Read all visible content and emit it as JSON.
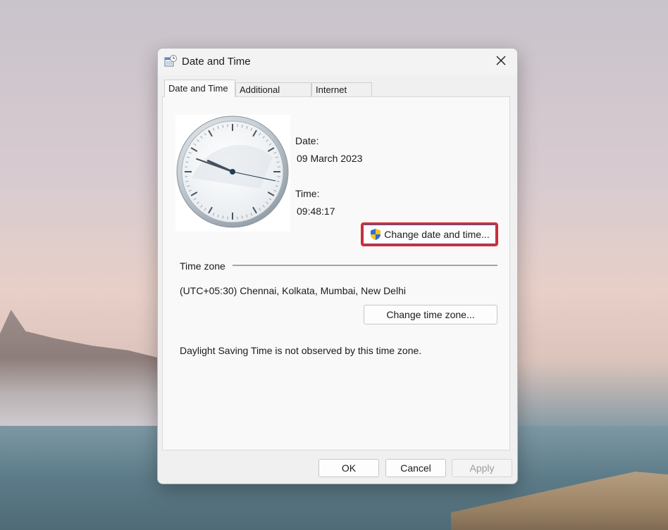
{
  "window": {
    "title": "Date and Time",
    "close_glyph": "✕"
  },
  "tabs": [
    {
      "label": "Date and Time",
      "active": true
    },
    {
      "label": "Additional Clocks",
      "active": false
    },
    {
      "label": "Internet Time",
      "active": false
    }
  ],
  "datetime": {
    "date_label": "Date:",
    "date_value": "09 March 2023",
    "time_label": "Time:",
    "time_value": "09:48:17",
    "change_button": "Change date and time..."
  },
  "timezone": {
    "section_label": "Time zone",
    "value": "(UTC+05:30) Chennai, Kolkata, Mumbai, New Delhi",
    "change_button": "Change time zone...",
    "dst_note": "Daylight Saving Time is not observed by this time zone."
  },
  "footer": {
    "ok": "OK",
    "cancel": "Cancel",
    "apply": "Apply"
  },
  "icons": {
    "title": "date-time-icon",
    "shield": "uac-shield-icon",
    "close": "close-icon"
  },
  "colors": {
    "highlight": "#e0282e",
    "focus": "#2f5fa7"
  }
}
